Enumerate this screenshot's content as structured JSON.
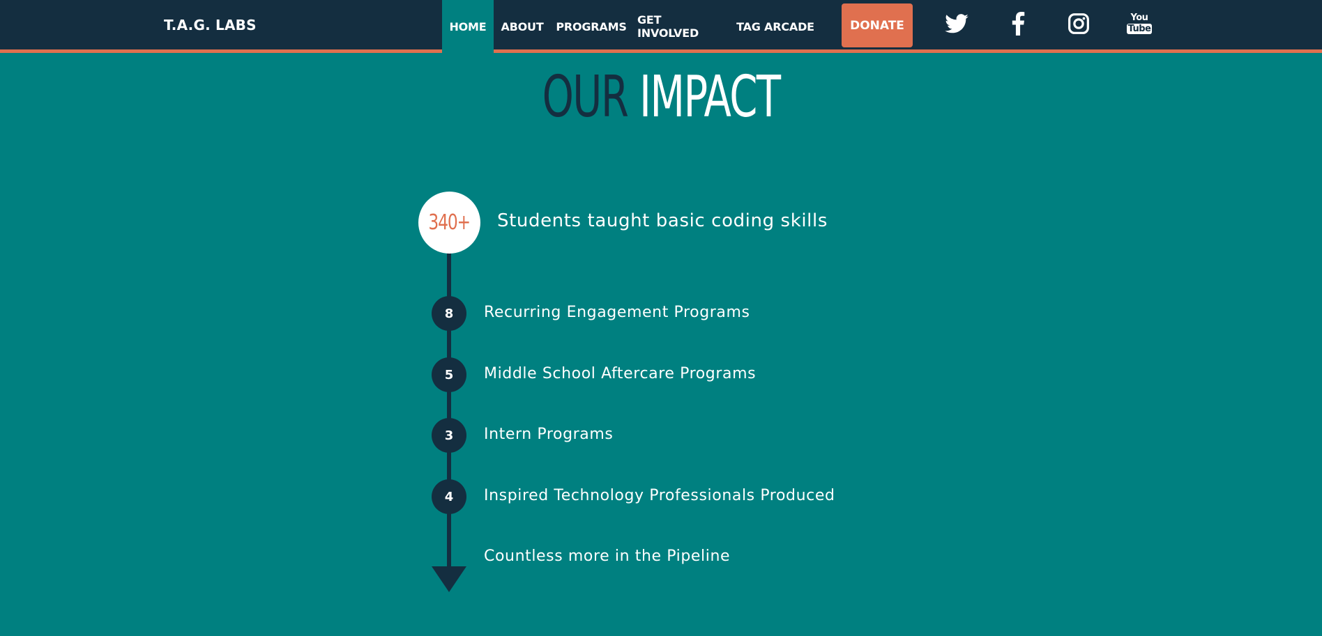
{
  "header": {
    "brand": "T.A.G. LABS",
    "nav": [
      {
        "label": "HOME",
        "active": true
      },
      {
        "label": "ABOUT",
        "active": false
      },
      {
        "label": "PROGRAMS",
        "active": false
      },
      {
        "label": "GET INVOLVED",
        "active": false
      },
      {
        "label": "TAG ARCADE",
        "active": false
      }
    ],
    "donate_label": "DONATE",
    "social": [
      {
        "icon": "twitter-icon"
      },
      {
        "icon": "facebook-icon"
      },
      {
        "icon": "instagram-icon"
      },
      {
        "icon": "youtube-icon",
        "text_top": "You",
        "text_bottom": "Tube"
      }
    ]
  },
  "impact": {
    "title_dark": "OUR",
    "title_light": "IMPACT",
    "headline": {
      "value": "340+",
      "label": "Students taught basic coding skills"
    },
    "items": [
      {
        "value": "8",
        "label": "Recurring Engagement Programs"
      },
      {
        "value": "5",
        "label": "Middle School Aftercare Programs"
      },
      {
        "value": "3",
        "label": "Intern Programs"
      },
      {
        "value": "4",
        "label": "Inspired Technology Professionals Produced"
      }
    ],
    "final_label": "Countless more in the Pipeline"
  },
  "colors": {
    "navy": "#142e40",
    "teal": "#008080",
    "accent": "#e0704f",
    "white": "#ffffff"
  }
}
